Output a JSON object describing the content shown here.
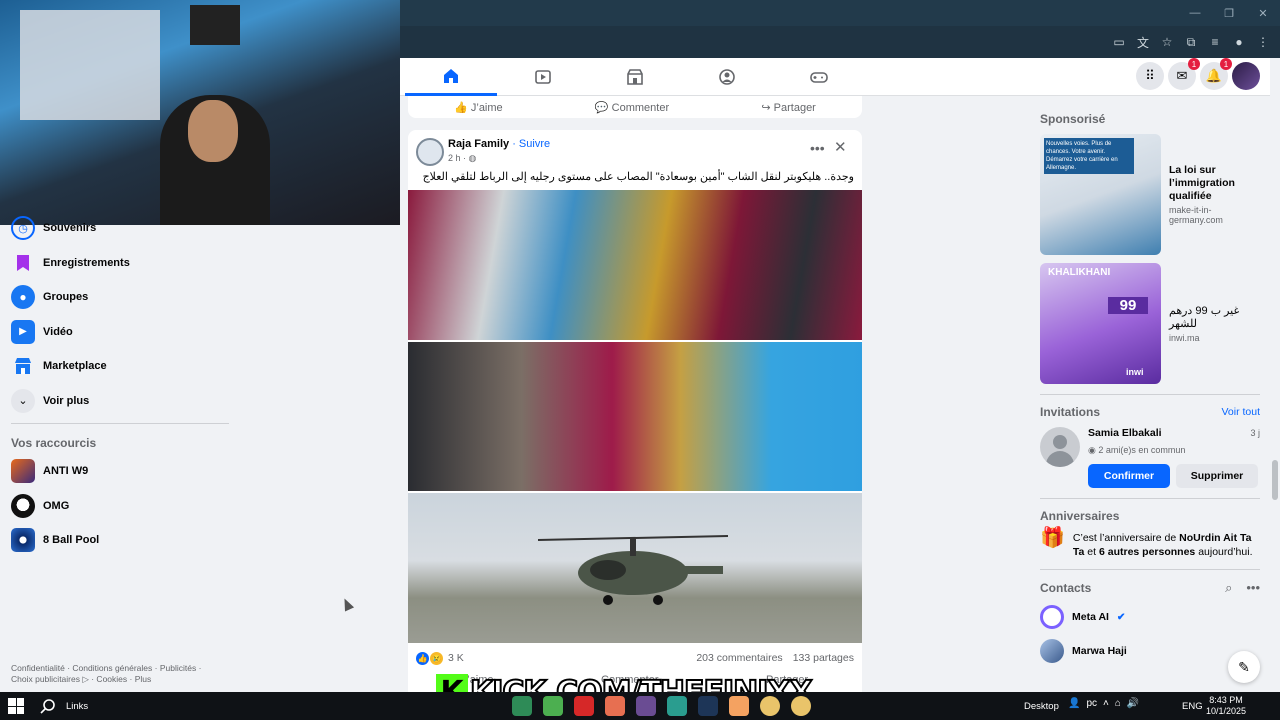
{
  "left_nav": {
    "items": [
      {
        "label": "Souvenirs",
        "icon": "clock-icon",
        "color": "#0866ff"
      },
      {
        "label": "Enregistrements",
        "icon": "bookmark-icon",
        "color": "#a431ea"
      },
      {
        "label": "Groupes",
        "icon": "groups-icon",
        "color": "#0866ff"
      },
      {
        "label": "Vidéo",
        "icon": "video-icon",
        "color": "#0866ff"
      },
      {
        "label": "Marketplace",
        "icon": "marketplace-icon",
        "color": "#0866ff"
      },
      {
        "label": "Voir plus",
        "icon": "chevron-down-icon",
        "color": "#e4e6eb"
      }
    ],
    "shortcuts_title": "Vos raccourcis",
    "shortcuts": [
      {
        "label": "ANTI W9"
      },
      {
        "label": "OMG"
      },
      {
        "label": "8 Ball Pool"
      }
    ],
    "footer": "Confidentialité · Conditions générales · Publicités · Choix publicitaires ▷ · Cookies · Plus"
  },
  "prev_post_actions": {
    "like": "J’aime",
    "comment": "Commenter",
    "share": "Partager"
  },
  "post": {
    "author": "Raja Family",
    "follow": "· Suivre",
    "time": "2 h ·",
    "text": "وجدة.. هليكوبتر لنقل الشاب \"أمين بوسعادة\" المصاب على مستوى رجليه إلى الرباط لتلقي العلاج",
    "reactions_count": "3 K",
    "comments": "203 commentaires",
    "shares": "133 partages",
    "actions": {
      "like": "J’aime",
      "comment": "Commenter",
      "share": "Partager"
    }
  },
  "right": {
    "sponsored_title": "Sponsorisé",
    "ads": [
      {
        "title": "La loi sur l’immigration qualifiée",
        "domain": "make-it-in-germany.com",
        "image_text": "Nouvelles voies. Plus de chances. Votre avenir. Démarrez votre carrière en Allemagne."
      },
      {
        "title": "غير ب 99 درهم للشهر",
        "domain": "inwi.ma",
        "image_text": "KHALIKHANI",
        "image_price": "99",
        "image_brand": "inwi"
      }
    ],
    "invitations_title": "Invitations",
    "see_all": "Voir tout",
    "invite": {
      "name": "Samia Elbakali",
      "time": "3 j",
      "mutual": "2 ami(e)s en commun",
      "confirm": "Confirmer",
      "delete": "Supprimer"
    },
    "birthdays_title": "Anniversaires",
    "birthday_pre": "C’est l’anniversaire de ",
    "birthday_name": "NoUrdin Ait Ta Ta",
    "birthday_mid": " et ",
    "birthday_others": "6 autres personnes",
    "birthday_post": " aujourd’hui.",
    "contacts_title": "Contacts",
    "contacts": [
      {
        "name": "Meta AI",
        "color": "#7b61ff"
      },
      {
        "name": "Marwa Haji",
        "color": "#3a5a8c"
      }
    ]
  },
  "overlay": {
    "kick_logo": "K",
    "kick_text": "KICK.COM/THEFINIXX"
  },
  "taskbar": {
    "links": "Links",
    "desktop": "Desktop",
    "lang": "ENG",
    "time": "8:43 PM",
    "date": "10/1/2025",
    "pc": "pc"
  },
  "colors": {
    "accent": "#0866ff",
    "kick_green": "#53fc18",
    "badge": "#e41e3f"
  }
}
